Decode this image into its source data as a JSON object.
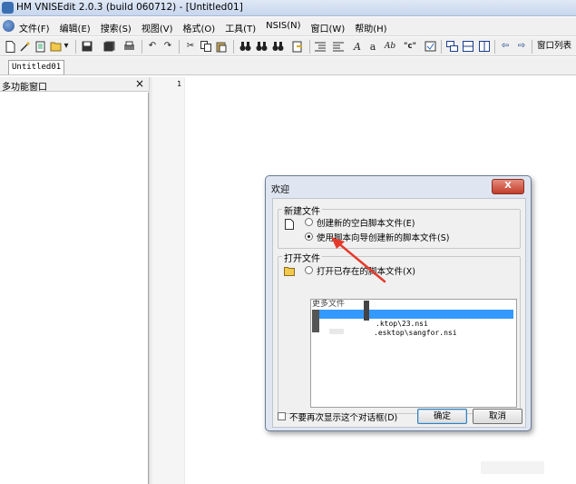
{
  "window": {
    "title": "HM VNISEdit 2.0.3 (build 060712) - [Untitled01]"
  },
  "menu": [
    "文件(F)",
    "编辑(E)",
    "搜索(S)",
    "视图(V)",
    "格式(O)",
    "工具(T)",
    "NSIS(N)",
    "窗口(W)",
    "帮助(H)"
  ],
  "toolbar": {
    "text_a": "A",
    "text_a2": "a",
    "text_ab": "Ab",
    "text_quote": "\"c\"",
    "window_list_label": "窗口列表"
  },
  "tabs": [
    "Untitled01"
  ],
  "panel": {
    "title": "多功能窗口",
    "close_glyph": "×"
  },
  "editor": {
    "line_number": "1"
  },
  "dialog": {
    "title": "欢迎",
    "new_group_title": "新建文件",
    "new_blank_label": "创建新的空白脚本文件(E)",
    "new_wizard_label": "使用脚本向导创建新的脚本文件(S)",
    "open_group_title": "打开文件",
    "open_existing_label": "打开已存在的脚本文件(X)",
    "recent_header": "更多文件",
    "recent_items": [
      ".ktop\\23.nsi",
      ".esktop\\sangfor.nsi"
    ],
    "dont_show_label": "不要再次显示这个对话框(D)",
    "ok_label": "确定",
    "cancel_label": "取消",
    "close_glyph": "X",
    "selected_option": "new_wizard"
  }
}
